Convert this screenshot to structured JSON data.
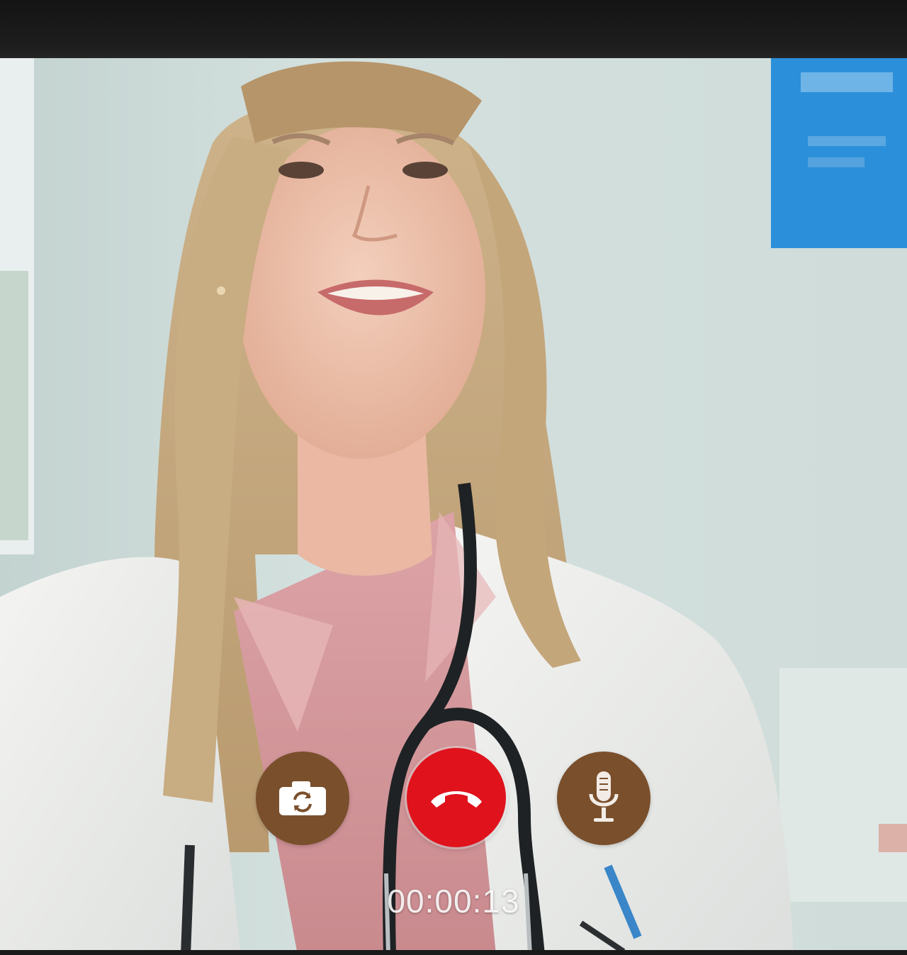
{
  "call": {
    "timer": "00:00:13"
  },
  "controls": [
    {
      "name": "switch-camera-button",
      "icon": "camera-switch-icon"
    },
    {
      "name": "end-call-button",
      "icon": "phone-hangup-icon"
    },
    {
      "name": "mic-button",
      "icon": "microphone-icon"
    }
  ],
  "colors": {
    "end_call": "#e0121c",
    "control_bg": "#7a4f2c",
    "top_bar": "#1a1a1a"
  },
  "video": {
    "subject": "doctor-video-feed"
  }
}
